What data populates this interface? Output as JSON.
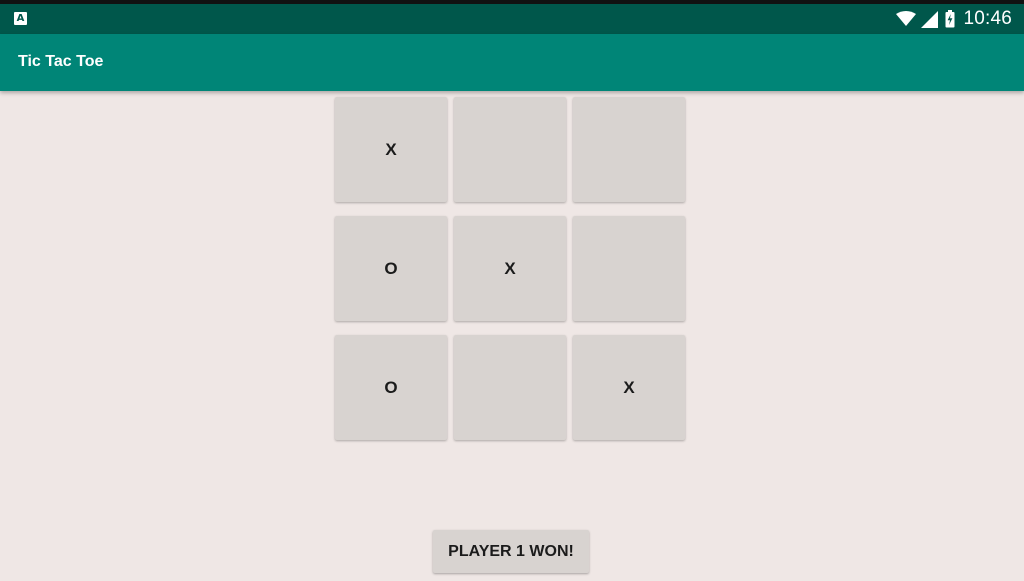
{
  "status_bar": {
    "time": "10:46",
    "app_icon_letter": "A",
    "icons": [
      "app-notification-icon",
      "wifi-icon",
      "cellular-signal-icon",
      "battery-charging-icon"
    ]
  },
  "app_bar": {
    "title": "Tic Tac Toe"
  },
  "board": {
    "rows": [
      [
        "X",
        "",
        ""
      ],
      [
        "O",
        "X",
        ""
      ],
      [
        "O",
        "",
        "X"
      ]
    ]
  },
  "game": {
    "status_label": "PLAYER 1 WON!"
  },
  "colors": {
    "status_bar": "#00574b",
    "app_bar": "#008577",
    "background": "#efe7e5",
    "cell": "#d8d3d0",
    "text": "#1b1b1b"
  }
}
